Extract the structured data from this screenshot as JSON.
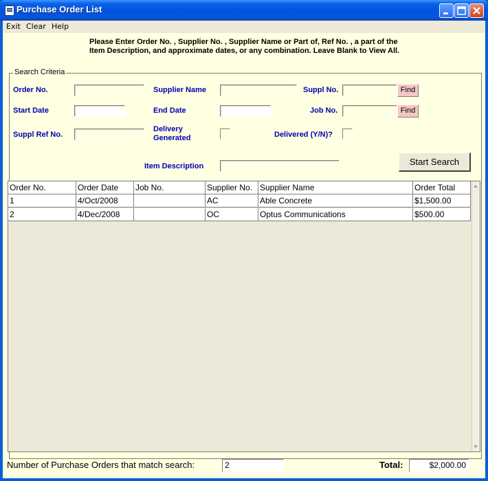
{
  "window": {
    "title": "Purchase Order List",
    "accent": "#0054e3"
  },
  "menu": {
    "exit": "Exit",
    "clear": "Clear",
    "help": "Help"
  },
  "instructions": "Please Enter Order No. , Supplier No. , Supplier Name or Part of, Ref No. , a part of the Item Description, and approximate dates, or any combination. Leave Blank to View All.",
  "search": {
    "group_label": "Search Criteria",
    "order_no_label": "Order No.",
    "supplier_name_label": "Supplier Name",
    "suppl_no_label": "Suppl No.",
    "start_date_label": "Start Date",
    "end_date_label": "End Date",
    "job_no_label": "Job No.",
    "suppl_ref_label": "Suppl Ref No.",
    "delivery_generated_label_1": "Delivery",
    "delivery_generated_label_2": "Generated",
    "delivered_label": "Delivered (Y/N)?",
    "item_description_label": "Item Description",
    "find_label": "Find",
    "start_search_label": "Start Search"
  },
  "grid": {
    "columns": [
      "Order No.",
      "Order Date",
      "Job No.",
      "Supplier No.",
      "Supplier Name",
      "Order Total"
    ],
    "rows": [
      [
        "1",
        "4/Oct/2008",
        "",
        "AC",
        "Able Concrete",
        "$1,500.00"
      ],
      [
        "2",
        "4/Dec/2008",
        "",
        "OC",
        "Optus Communications",
        "$500.00"
      ]
    ]
  },
  "footer": {
    "count_label": "Number of Purchase Orders that match search:",
    "count_value": "2",
    "total_label": "Total:",
    "total_value": "$2,000.00"
  }
}
